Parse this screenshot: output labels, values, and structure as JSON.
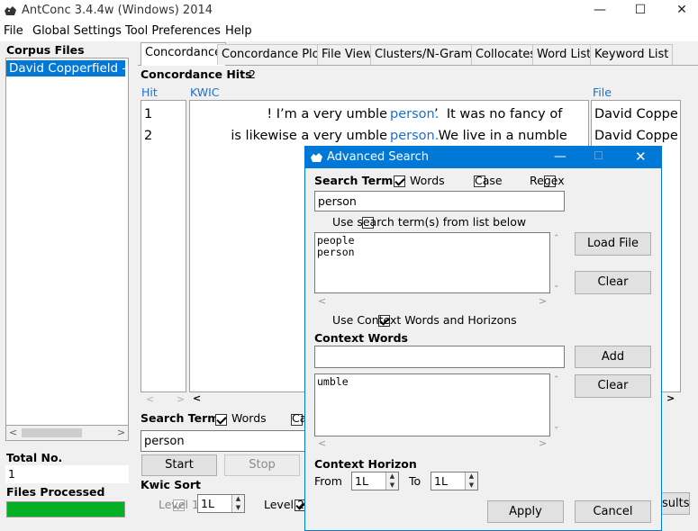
{
  "window": {
    "title": "AntConc 3.4.4w (Windows) 2014"
  },
  "menu": [
    "File",
    "Global Settings",
    "Tool Preferences",
    "Help"
  ],
  "sidebar": {
    "corpus_files_label": "Corpus Files",
    "corpus_files": [
      "David Copperfield - C"
    ],
    "total_no_label": "Total No.",
    "total_no_value": "1",
    "files_processed_label": "Files Processed",
    "files_processed_progress": 1.0
  },
  "tabs": [
    "Concordance",
    "Concordance Plot",
    "File View",
    "Clusters/N-Grams",
    "Collocates",
    "Word List",
    "Keyword List"
  ],
  "concordance": {
    "hits_label": "Concordance Hits",
    "hits_count": "2",
    "columns": {
      "hit": "Hit",
      "kwic": "KWIC",
      "file": "File"
    },
    "rows": [
      {
        "hit": "1",
        "left": "! I’m a very umble",
        "keyword": "person.",
        "right": "’  It was no fancy of",
        "file": "David Coppe"
      },
      {
        "hit": "2",
        "left": "is likewise a very umble",
        "keyword": "person.",
        "right": " We live in a numble",
        "file": "David Coppe"
      }
    ],
    "search_term_label": "Search Term",
    "words_label": "Words",
    "case_partial": "Ca",
    "search_value": "person",
    "start_label": "Start",
    "stop_label": "Stop",
    "kwic_sort_label": "Kwic Sort",
    "level1_label": "Level 1",
    "level1_value": "1L",
    "level2_label": "Level 2",
    "results_partial": "sults"
  },
  "dialog": {
    "title": "Advanced Search",
    "search_term_label": "Search Term",
    "words_label": "Words",
    "words_checked": true,
    "case_label": "Case",
    "case_checked": false,
    "regex_label": "Regex",
    "regex_checked": false,
    "search_value": "person",
    "use_list_label": "Use search term(s) from list below",
    "use_list_checked": false,
    "term_list": [
      "people",
      "person"
    ],
    "load_file_label": "Load File",
    "clear_label": "Clear",
    "use_context_label": "Use Context Words and Horizons",
    "use_context_checked": true,
    "context_words_label": "Context Words",
    "context_word_value": "",
    "add_label": "Add",
    "context_list": [
      "umble"
    ],
    "clear2_label": "Clear",
    "context_horizon_label": "Context Horizon",
    "from_label": "From",
    "from_value": "1L",
    "to_label": "To",
    "to_value": "1L",
    "apply_label": "Apply",
    "cancel_label": "Cancel"
  }
}
